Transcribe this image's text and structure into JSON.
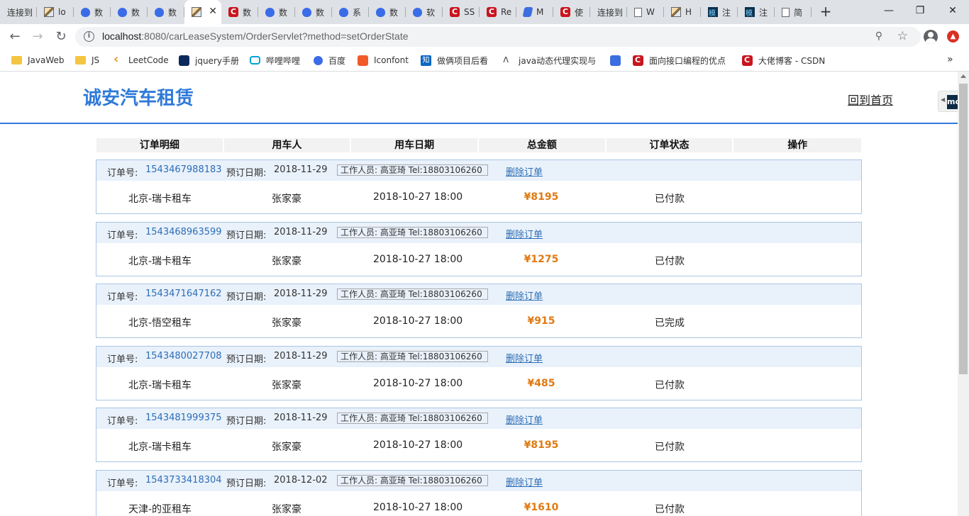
{
  "browser": {
    "tabs": [
      {
        "title": "连接到",
        "icon": "none",
        "active": false
      },
      {
        "title": "lo",
        "icon": "image-favicon-icon",
        "active": false
      },
      {
        "title": "数",
        "icon": "baidu-paw-icon",
        "active": false
      },
      {
        "title": "数",
        "icon": "baidu-paw-icon",
        "active": false
      },
      {
        "title": "数",
        "icon": "baidu-paw-icon",
        "active": false
      },
      {
        "title": "",
        "icon": "image-favicon-icon",
        "active": true
      },
      {
        "title": "数",
        "icon": "csdn-icon",
        "active": false
      },
      {
        "title": "数",
        "icon": "baidu-paw-icon",
        "active": false
      },
      {
        "title": "数",
        "icon": "baidu-paw-icon",
        "active": false
      },
      {
        "title": "系",
        "icon": "baidu-paw-icon",
        "active": false
      },
      {
        "title": "数",
        "icon": "baidu-paw-icon",
        "active": false
      },
      {
        "title": "软",
        "icon": "baidu-paw-icon",
        "active": false
      },
      {
        "title": "SS",
        "icon": "csdn-icon",
        "active": false
      },
      {
        "title": "Re",
        "icon": "csdn-icon",
        "active": false
      },
      {
        "title": "M",
        "icon": "feather-icon",
        "active": false
      },
      {
        "title": "使",
        "icon": "csdn-icon",
        "active": false
      },
      {
        "title": "连接到",
        "icon": "none",
        "active": false
      },
      {
        "title": "W",
        "icon": "document-icon",
        "active": false
      },
      {
        "title": "H",
        "icon": "image-favicon-icon",
        "active": false
      },
      {
        "title": "注",
        "icon": "moke-icon",
        "active": false
      },
      {
        "title": "注",
        "icon": "moke-icon",
        "active": false
      },
      {
        "title": "简",
        "icon": "document-icon",
        "active": false
      }
    ],
    "url_host": "localhost",
    "url_rest": ":8080/carLeaseSystem/OrderServlet?method=setOrderState",
    "bookmarks": [
      {
        "label": "JavaWeb",
        "icon": "folder-icon"
      },
      {
        "label": "JS",
        "icon": "folder-icon"
      },
      {
        "label": "LeetCode",
        "icon": "leetcode-icon"
      },
      {
        "label": "jquery手册",
        "icon": "jquery-icon"
      },
      {
        "label": "哔哩哔哩",
        "icon": "bilibili-icon"
      },
      {
        "label": "百度",
        "icon": "baidu-paw-icon"
      },
      {
        "label": "Iconfont",
        "icon": "iconfont-icon"
      },
      {
        "label": "做俩项目后看",
        "icon": "zhihu-icon"
      },
      {
        "label": "java动态代理实现与",
        "icon": "alibaba-icon"
      },
      {
        "label": "",
        "icon": "feather-icon"
      },
      {
        "label": "面向接口编程的优点",
        "icon": "csdn-icon"
      },
      {
        "label": "大佬博客 - CSDN",
        "icon": "csdn-icon"
      }
    ]
  },
  "site": {
    "title": "诚安汽车租赁",
    "home_link": "回到首页",
    "side_tab_text": "mo"
  },
  "table": {
    "headers": [
      "订单明细",
      "用车人",
      "用车日期",
      "总金额",
      "订单状态",
      "操作"
    ],
    "order_no_label": "订单号:",
    "booking_date_label": "预订日期:",
    "delete_label": "删除订单",
    "orders": [
      {
        "id": "1543467988183",
        "booked": "2018-11-29",
        "staff": "工作人员:  高亚琦  Tel:18803106260",
        "route": "北京-瑞卡租车",
        "user": "张家豪",
        "use_date": "2018-10-27 18:00",
        "amount": "¥8195",
        "state": "已付款"
      },
      {
        "id": "1543468963599",
        "booked": "2018-11-29",
        "staff": "工作人员:  高亚琦  Tel:18803106260",
        "route": "北京-瑞卡租车",
        "user": "张家豪",
        "use_date": "2018-10-27 18:00",
        "amount": "¥1275",
        "state": "已付款"
      },
      {
        "id": "1543471647162",
        "booked": "2018-11-29",
        "staff": "工作人员:  高亚琦  Tel:18803106260",
        "route": "北京-悟空租车",
        "user": "张家豪",
        "use_date": "2018-10-27 18:00",
        "amount": "¥915",
        "state": "已完成"
      },
      {
        "id": "1543480027708",
        "booked": "2018-11-29",
        "staff": "工作人员:  高亚琦  Tel:18803106260",
        "route": "北京-瑞卡租车",
        "user": "张家豪",
        "use_date": "2018-10-27 18:00",
        "amount": "¥485",
        "state": "已付款"
      },
      {
        "id": "1543481999375",
        "booked": "2018-11-29",
        "staff": "工作人员:  高亚琦  Tel:18803106260",
        "route": "北京-瑞卡租车",
        "user": "张家豪",
        "use_date": "2018-10-27 18:00",
        "amount": "¥8195",
        "state": "已付款"
      },
      {
        "id": "1543733418304",
        "booked": "2018-12-02",
        "staff": "工作人员:  高亚琦  Tel:18803106260",
        "route": "天津-的亚租车",
        "user": "张家豪",
        "use_date": "2018-10-27 18:00",
        "amount": "¥1610",
        "state": "已付款"
      }
    ]
  },
  "colors": {
    "brand_blue": "#2f7ad9",
    "amount_orange": "#e07a12",
    "link_blue": "#2d6eb5",
    "meta_row_bg": "#e9f1fb",
    "order_border": "#aac6e4"
  }
}
